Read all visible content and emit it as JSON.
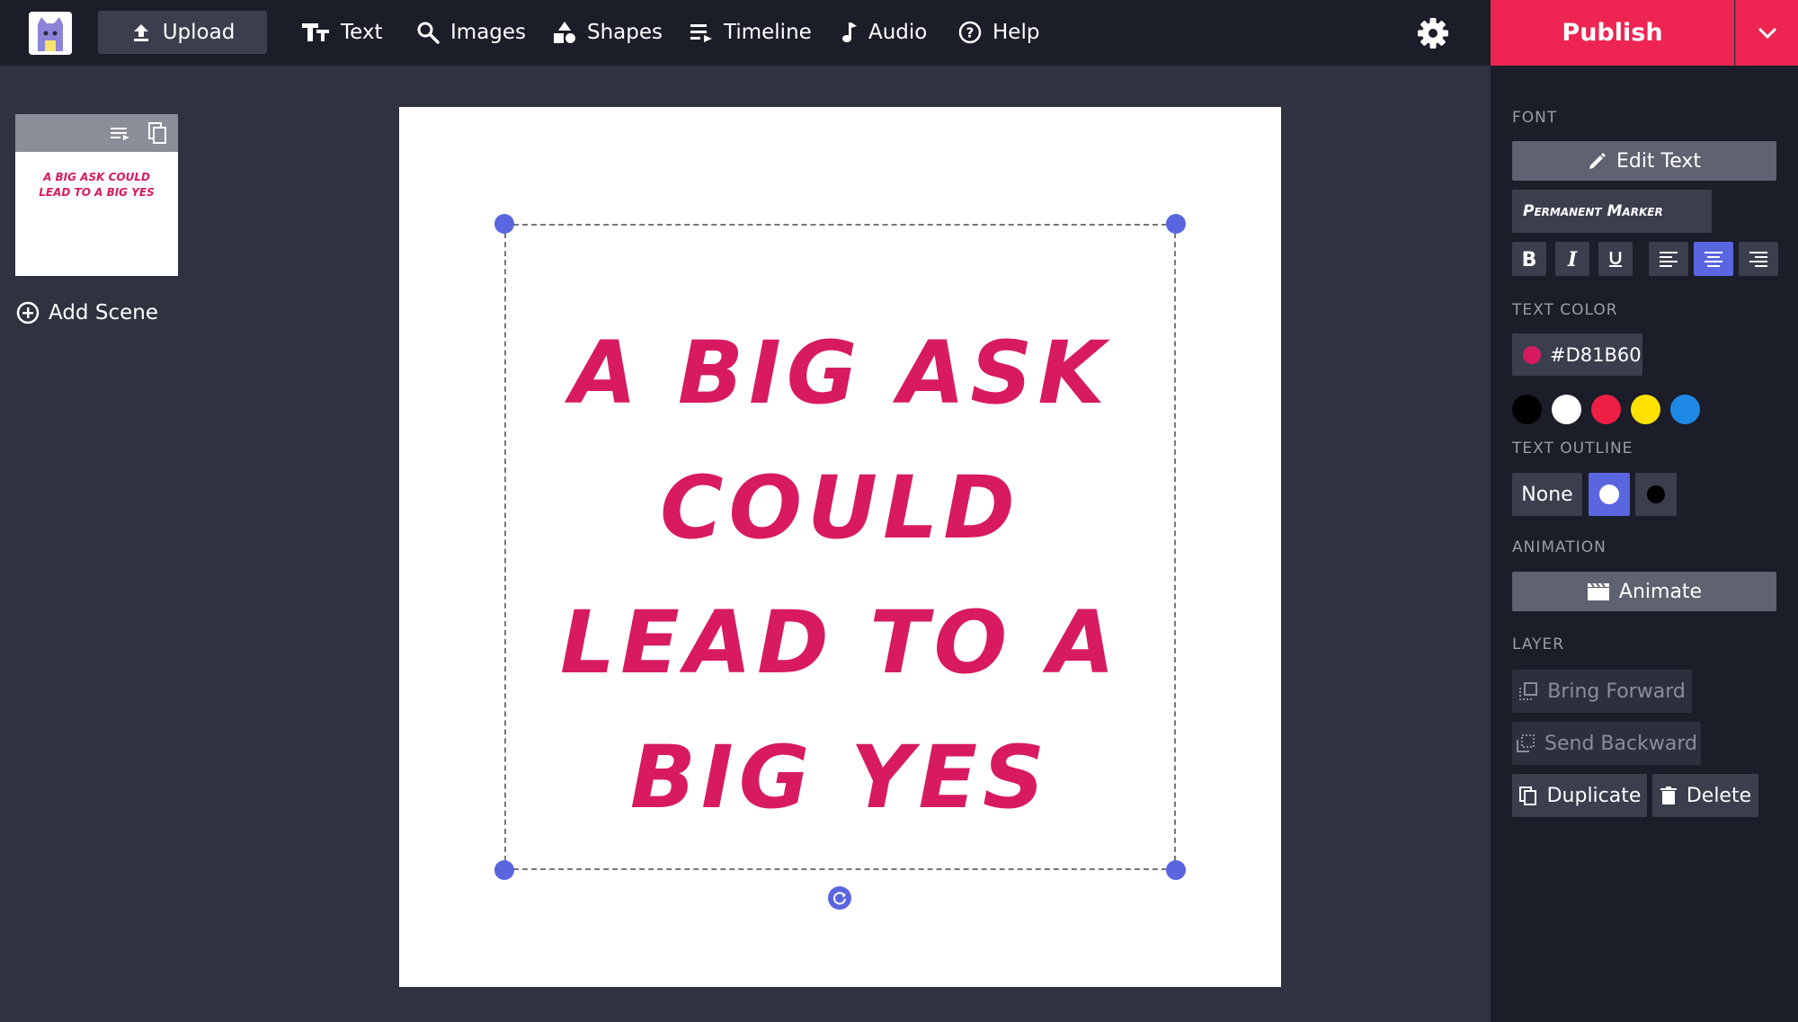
{
  "nav": {
    "upload": "Upload",
    "text": "Text",
    "images": "Images",
    "shapes": "Shapes",
    "timeline": "Timeline",
    "audio": "Audio",
    "help": "Help",
    "publish": "Publish"
  },
  "scenes": {
    "thumb_text": "A big ask could lead to a big yes",
    "add_scene": "Add Scene"
  },
  "canvas": {
    "text_lines": "A BIG ASK\nCOULD\nLEAD TO A\nBIG YES",
    "text_color": "#D81B60"
  },
  "panel": {
    "font_label": "FONT",
    "edit_text": "Edit Text",
    "font_name": "Permanent Marker",
    "text_color_label": "TEXT COLOR",
    "text_color_value": "#D81B60",
    "swatches": [
      "#000000",
      "#ffffff",
      "#ee1e45",
      "#ffe100",
      "#1e88e5"
    ],
    "text_outline_label": "TEXT OUTLINE",
    "outline_none": "None",
    "animation_label": "ANIMATION",
    "animate": "Animate",
    "layer_label": "LAYER",
    "bring_forward": "Bring Forward",
    "send_backward": "Send Backward",
    "duplicate": "Duplicate",
    "delete": "Delete"
  }
}
